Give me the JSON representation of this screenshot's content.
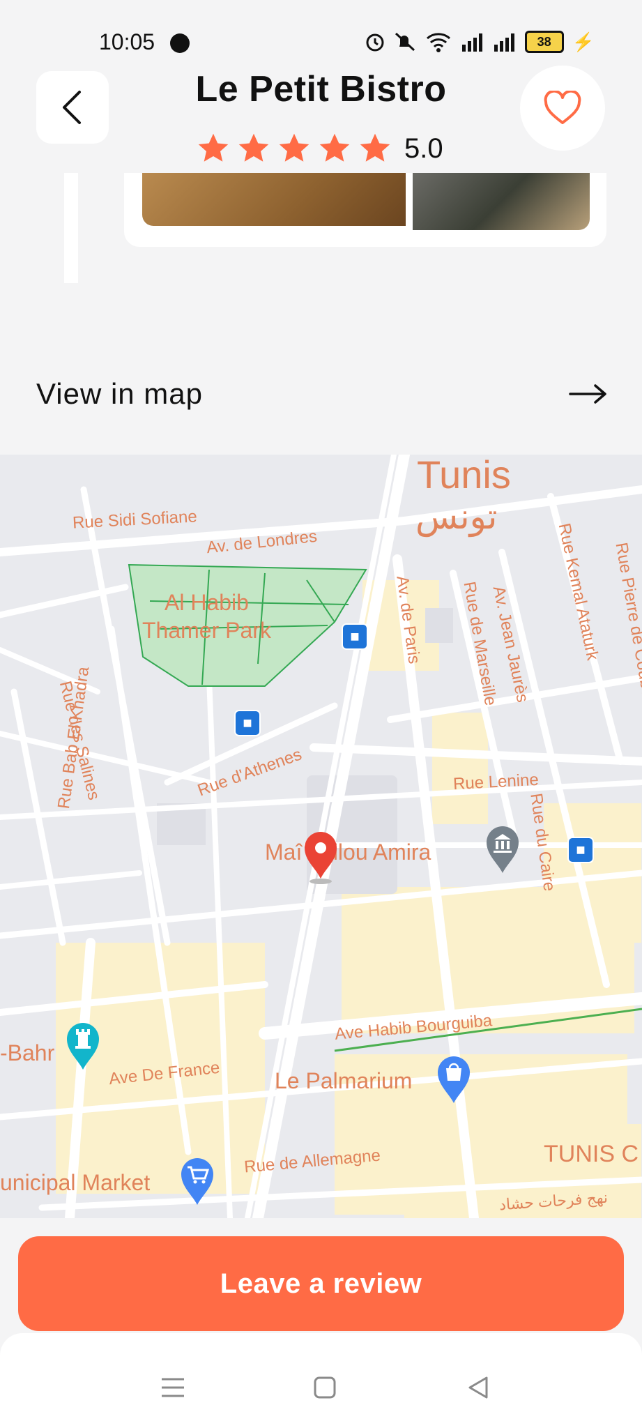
{
  "status_bar": {
    "time": "10:05",
    "battery": "38"
  },
  "header": {
    "title": "Le Petit Bistro",
    "rating": "5.0",
    "stars": 5
  },
  "view_map": {
    "label": "View in map"
  },
  "map": {
    "labels": {
      "tunis": "Tunis",
      "tunis_ar": "تونس",
      "rue_sidi_sofiane": "Rue Sidi Sofiane",
      "av_londres": "Av. de Londres",
      "park1": "Al Habib",
      "park2": "Thamer Park",
      "rue_salines": "Rue des Salines",
      "rue_bab_khadra": "Rue Bab El Khadra",
      "av_paris": "Av. de Paris",
      "rue_marseille": "Rue de Marseille",
      "av_jean_jaures": "Av. Jean Jaurès",
      "rue_kemal": "Rue Kemal Ataturk",
      "rue_pierre": "Rue Pierre de Coubertin",
      "rue_athenes": "Rue d'Athenes",
      "rue_lenine": "Rue Lenine",
      "rue_caire": "Rue du Caire",
      "pin_place": "Maî  Alilou Amira",
      "ave_bourguiba": "Ave Habib Bourguiba",
      "bahr": "-Bahr",
      "ave_france": "Ave De France",
      "le_palmarium": "Le Palmarium",
      "tunis_c": "TUNIS C",
      "municipal_market": "unicipal Market",
      "rue_allemagne": "Rue de Allemagne",
      "ar_street": "نهج فرحات حشاد"
    }
  },
  "cta": {
    "label": "Leave a review"
  },
  "colors": {
    "accent": "#ff6b45",
    "map_label": "#e0835a",
    "park": "#c4e7c6"
  }
}
